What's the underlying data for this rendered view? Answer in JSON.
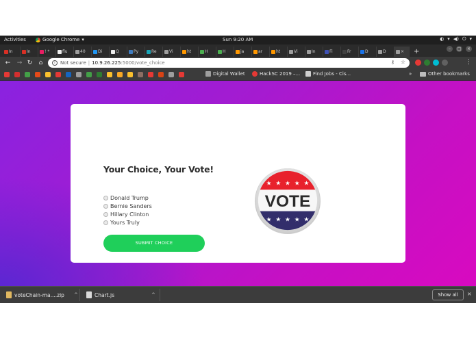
{
  "gnome": {
    "activities": "Activities",
    "app_name": "Google Chrome",
    "app_arrow": "▾",
    "clock": "Sun  9:20 AM",
    "tray": [
      "◐",
      "▾",
      "◀)",
      "⏻",
      "▾"
    ]
  },
  "tabs": [
    {
      "label": "In",
      "color": "#d93025"
    },
    {
      "label": "In",
      "color": "#d93025"
    },
    {
      "label": "! *",
      "color": "#e91e63"
    },
    {
      "label": "flu",
      "color": "#eeeeee"
    },
    {
      "label": "40",
      "color": "#9e9e9e"
    },
    {
      "label": "Di",
      "color": "#2196f3"
    },
    {
      "label": "Q",
      "color": "#eeeeee"
    },
    {
      "label": "Py",
      "color": "#3f7cc0"
    },
    {
      "label": "Re",
      "color": "#19a6b8"
    },
    {
      "label": "Vi",
      "color": "#9e9e9e"
    },
    {
      "label": "ht",
      "color": "#ff9800"
    },
    {
      "label": "H",
      "color": "#4caf50"
    },
    {
      "label": "H",
      "color": "#4caf50"
    },
    {
      "label": "ja",
      "color": "#ff9800"
    },
    {
      "label": "ar",
      "color": "#ff9800"
    },
    {
      "label": "ht",
      "color": "#ff9800"
    },
    {
      "label": "Vi",
      "color": "#9e9e9e"
    },
    {
      "label": "In",
      "color": "#9e9e9e"
    },
    {
      "label": "Fi",
      "color": "#3f51b5"
    },
    {
      "label": "Fr",
      "color": "#424242"
    },
    {
      "label": "D",
      "color": "#1a73e8"
    },
    {
      "label": "D",
      "color": "#9e9e9e"
    },
    {
      "label": "×",
      "color": "#9e9e9e"
    }
  ],
  "new_tab": "+",
  "omnibox": {
    "not_secure": "Not secure",
    "separator": "|",
    "host": "10.9.26.225",
    "path": ":5000/vote_choice",
    "key_icon": "⚷",
    "star_icon": "☆"
  },
  "ext_colors": [
    "#e53935",
    "#2e7d32",
    "#00bcd4",
    "#616161"
  ],
  "bookmark_icon_colors": [
    "#e53935",
    "#d32f2f",
    "#43a047",
    "#e64a19",
    "#fbc02d",
    "#e53935",
    "#1565c0",
    "#9e9e9e",
    "#43a047",
    "#2e7d32",
    "#fbc02d",
    "#f9a825",
    "#fbc02d",
    "#8d6e63",
    "#e53935",
    "#d84315",
    "#9e9e9e",
    "#e53935"
  ],
  "bookmarks": {
    "digital_wallet": "Digital Wallet",
    "hacksc": "HackSC 2019 –...",
    "find_jobs": "Find Jobs - Cis...",
    "chevron": "»",
    "other": "Other bookmarks"
  },
  "vote": {
    "title": "Your Choice, Your Vote!",
    "options": [
      "Donald Trump",
      "Bernie Sanders",
      "Hillary Clinton",
      "Yours Truly"
    ],
    "submit": "SUBMIT CHOICE",
    "badge_text": "VOTE",
    "colors": {
      "accent": "#1fcf5a",
      "badge_red": "#e8212c",
      "badge_navy": "#322e6b"
    }
  },
  "downloads": {
    "item1": "voteChain-ma....zip",
    "item2": "Chart.js",
    "chevron": "^",
    "show_all": "Show all",
    "close": "×"
  }
}
